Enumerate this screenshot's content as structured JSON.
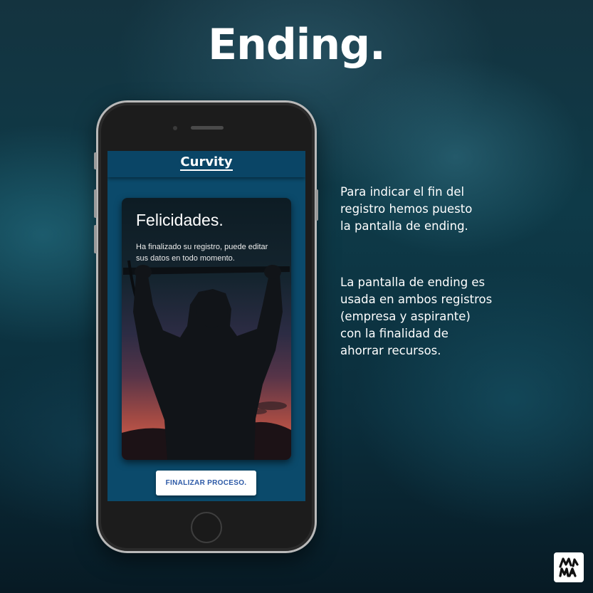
{
  "page": {
    "title": "Ending."
  },
  "phone": {
    "app": {
      "logo": "Curvity",
      "card": {
        "title": "Felicidades.",
        "text": "Ha finalizado su registro, puede editar sus datos en todo momento."
      },
      "finish_button_label": "FINALIZAR PROCESO."
    }
  },
  "description": {
    "paragraph_1": "Para indicar el fin del\nregistro hemos puesto\nla pantalla de ending.",
    "paragraph_2": "La pantalla de ending es\nusada en ambos registros\n(empresa y aspirante)\ncon la finalidad de\nahorrar recursos."
  },
  "brand_logo": {
    "icon": "mina-logo-icon"
  },
  "colors": {
    "accent": "#0b4a6b",
    "button_text": "#2b58a6"
  }
}
